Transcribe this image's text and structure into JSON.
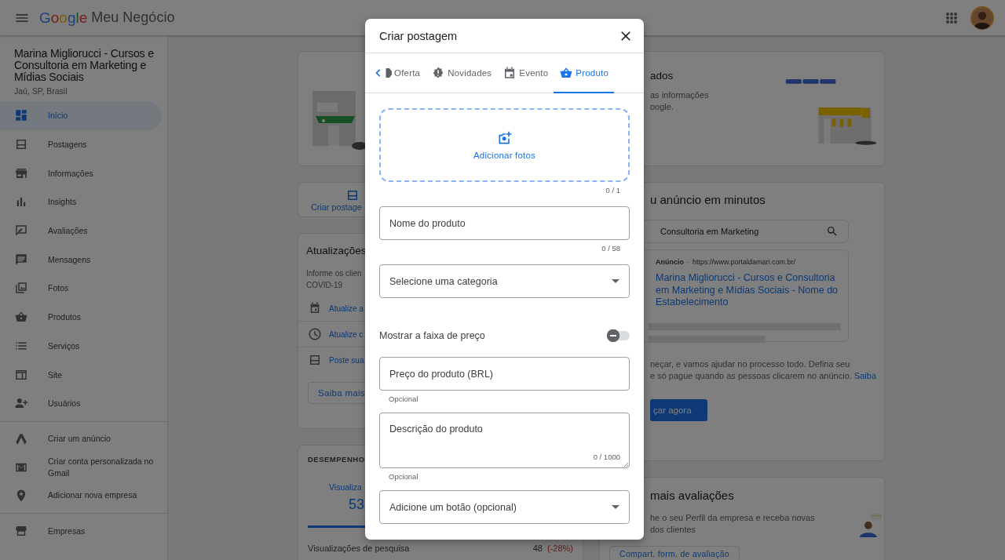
{
  "app_bar": {
    "logo_word": "Google",
    "product": "Meu Negócio"
  },
  "sidebar": {
    "business_name": "Marina Migliorucci - Cursos e Consultoria em Marketing e Mídias Sociais",
    "location": "Jaú, SP, Brasil",
    "items": [
      {
        "label": "Início",
        "selected": true
      },
      {
        "label": "Postagens",
        "selected": false
      },
      {
        "label": "Informações",
        "selected": false
      },
      {
        "label": "Insights",
        "selected": false
      },
      {
        "label": "Avaliações",
        "selected": false
      },
      {
        "label": "Mensagens",
        "selected": false
      },
      {
        "label": "Fotos",
        "selected": false
      },
      {
        "label": "Produtos",
        "selected": false
      },
      {
        "label": "Serviços",
        "selected": false
      },
      {
        "label": "Site",
        "selected": false
      },
      {
        "label": "Usuários",
        "selected": false
      }
    ],
    "extra_items": [
      {
        "label": "Criar um anúncio"
      },
      {
        "label": "Criar conta personalizada no Gmail"
      },
      {
        "label": "Adicionar nova empresa"
      }
    ],
    "footer_items": [
      {
        "label": "Empresas"
      }
    ]
  },
  "left_column": {
    "create_post": {
      "label": "Criar postage"
    },
    "updates": {
      "title": "Atualizações",
      "lines": [
        "Informe os clien",
        "COVID-19"
      ],
      "links": [
        "Atualize a",
        "Atualize c",
        "Poste sua"
      ],
      "button": "Saiba mais"
    },
    "performance": {
      "heading": "DESEMPENHO",
      "tab": {
        "label": "Visualiza",
        "value": "53",
        "selected": true
      },
      "rows": [
        {
          "label": "Visualizações de pesquisa",
          "value": "48",
          "change": "(-28%)"
        }
      ]
    }
  },
  "right_column": {
    "profile": {
      "title": "ados",
      "lines": [
        "as informações",
        "oogle."
      ]
    },
    "ads": {
      "title": "u anúncio em minutos",
      "search_query": "Consultoria em Marketing",
      "ad_label": "Anúncio",
      "ad_separator": "·",
      "ad_url": "https://www.portaldamari.com.br/",
      "ad_title": "Marina Migliorucci - Cursos e Consultoria em Marketing e Mídias Sociais - Nome do Estabelecimento",
      "lines": [
        "neçar, e vamos ajudar no processo todo. Defina seu",
        "e só pague quando as pessoas clicarem no anúncio."
      ],
      "link": "Saiba",
      "button": "çar agora"
    },
    "reviews": {
      "title": "mais avaliações",
      "lines": [
        "he o seu Perfil da empresa e receba novas",
        "dos clientes"
      ],
      "button": "Compart. form. de avaliação"
    }
  },
  "dialog": {
    "title": "Criar postagem",
    "tabs": [
      {
        "label": "Oferta",
        "selected": false
      },
      {
        "label": "Novidades",
        "selected": false
      },
      {
        "label": "Evento",
        "selected": false
      },
      {
        "label": "Produto",
        "selected": true
      }
    ],
    "photo": {
      "label": "Adicionar fotos",
      "counter": "0 / 1"
    },
    "fields": [
      {
        "kind": "text",
        "placeholder": "Nome do produto",
        "counter": "0 / 58"
      },
      {
        "kind": "select",
        "label": "Selecione uma categoria"
      },
      {
        "kind": "toggle",
        "label": "Mostrar a faixa de preço",
        "on": false
      },
      {
        "kind": "text",
        "placeholder": "Preço do produto (BRL)",
        "helper": "Opcional"
      },
      {
        "kind": "textarea",
        "placeholder": "Descrição do produto",
        "counter": "0 / 1000",
        "helper": "Opcional"
      },
      {
        "kind": "select",
        "label": "Adicione um botão (opcional)"
      }
    ]
  }
}
